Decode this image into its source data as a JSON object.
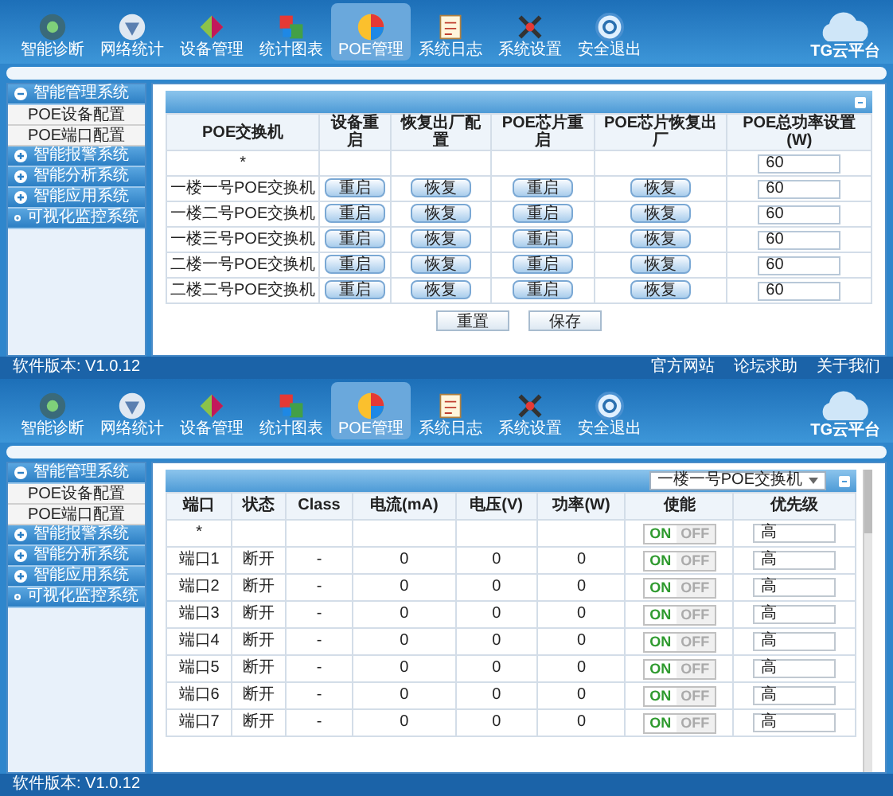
{
  "screens": [
    {
      "nav": [
        {
          "label": "智能诊断",
          "selected": false
        },
        {
          "label": "网络统计",
          "selected": false
        },
        {
          "label": "设备管理",
          "selected": false
        },
        {
          "label": "统计图表",
          "selected": false
        },
        {
          "label": "POE管理",
          "selected": true
        },
        {
          "label": "系统日志",
          "selected": false
        },
        {
          "label": "系统设置",
          "selected": false
        },
        {
          "label": "安全退出",
          "selected": false
        }
      ],
      "logo": "TG云平台",
      "sidebar": [
        {
          "label": "智能管理系统",
          "expanded": true,
          "children": [
            {
              "label": "POE设备配置"
            },
            {
              "label": "POE端口配置"
            }
          ]
        },
        {
          "label": "智能报警系统",
          "expanded": false
        },
        {
          "label": "智能分析系统",
          "expanded": false
        },
        {
          "label": "智能应用系统",
          "expanded": false
        },
        {
          "label": "可视化监控系统",
          "expanded": false
        }
      ],
      "panel": {
        "kind": "switch_table",
        "columns": [
          "POE交换机",
          "设备重启",
          "恢复出厂配置",
          "POE芯片重启",
          "POE芯片恢复出厂",
          "POE总功率设置(W)"
        ],
        "rows": [
          {
            "name": "*",
            "power": "60"
          },
          {
            "name": "一楼一号POE交换机",
            "restart": "重启",
            "reset": "恢复",
            "chip_restart": "重启",
            "chip_reset": "恢复",
            "power": "60"
          },
          {
            "name": "一楼二号POE交换机",
            "restart": "重启",
            "reset": "恢复",
            "chip_restart": "重启",
            "chip_reset": "恢复",
            "power": "60"
          },
          {
            "name": "一楼三号POE交换机",
            "restart": "重启",
            "reset": "恢复",
            "chip_restart": "重启",
            "chip_reset": "恢复",
            "power": "60"
          },
          {
            "name": "二楼一号POE交换机",
            "restart": "重启",
            "reset": "恢复",
            "chip_restart": "重启",
            "chip_reset": "恢复",
            "power": "60"
          },
          {
            "name": "二楼二号POE交换机",
            "restart": "重启",
            "reset": "恢复",
            "chip_restart": "重启",
            "chip_reset": "恢复",
            "power": "60"
          }
        ],
        "buttons": [
          "重置",
          "保存"
        ]
      },
      "footer": {
        "version": "软件版本: V1.0.12",
        "links": [
          "官方网站",
          "论坛求助",
          "关于我们"
        ]
      }
    },
    {
      "nav": [
        {
          "label": "智能诊断",
          "selected": false
        },
        {
          "label": "网络统计",
          "selected": false
        },
        {
          "label": "设备管理",
          "selected": false
        },
        {
          "label": "统计图表",
          "selected": false
        },
        {
          "label": "POE管理",
          "selected": true
        },
        {
          "label": "系统日志",
          "selected": false
        },
        {
          "label": "系统设置",
          "selected": false
        },
        {
          "label": "安全退出",
          "selected": false
        }
      ],
      "logo": "TG云平台",
      "sidebar": [
        {
          "label": "智能管理系统",
          "expanded": true,
          "children": [
            {
              "label": "POE设备配置"
            },
            {
              "label": "POE端口配置"
            }
          ]
        },
        {
          "label": "智能报警系统",
          "expanded": false
        },
        {
          "label": "智能分析系统",
          "expanded": false
        },
        {
          "label": "智能应用系统",
          "expanded": false
        },
        {
          "label": "可视化监控系统",
          "expanded": false
        }
      ],
      "panel": {
        "kind": "port_table",
        "switch_select": "一楼一号POE交换机",
        "columns": [
          "端口",
          "状态",
          "Class",
          "电流(mA)",
          "电压(V)",
          "功率(W)",
          "使能",
          "优先级"
        ],
        "rows": [
          {
            "port": "*",
            "enable": {
              "on": true,
              "on_text": "ON",
              "off_text": "OFF"
            },
            "priority": "高"
          },
          {
            "port": "端口1",
            "status": "断开",
            "class": "-",
            "current": "0",
            "voltage": "0",
            "power": "0",
            "enable": {
              "on": true,
              "on_text": "ON",
              "off_text": "OFF"
            },
            "priority": "高"
          },
          {
            "port": "端口2",
            "status": "断开",
            "class": "-",
            "current": "0",
            "voltage": "0",
            "power": "0",
            "enable": {
              "on": true,
              "on_text": "ON",
              "off_text": "OFF"
            },
            "priority": "高"
          },
          {
            "port": "端口3",
            "status": "断开",
            "class": "-",
            "current": "0",
            "voltage": "0",
            "power": "0",
            "enable": {
              "on": true,
              "on_text": "ON",
              "off_text": "OFF"
            },
            "priority": "高"
          },
          {
            "port": "端口4",
            "status": "断开",
            "class": "-",
            "current": "0",
            "voltage": "0",
            "power": "0",
            "enable": {
              "on": true,
              "on_text": "ON",
              "off_text": "OFF"
            },
            "priority": "高"
          },
          {
            "port": "端口5",
            "status": "断开",
            "class": "-",
            "current": "0",
            "voltage": "0",
            "power": "0",
            "enable": {
              "on": true,
              "on_text": "ON",
              "off_text": "OFF"
            },
            "priority": "高"
          },
          {
            "port": "端口6",
            "status": "断开",
            "class": "-",
            "current": "0",
            "voltage": "0",
            "power": "0",
            "enable": {
              "on": true,
              "on_text": "ON",
              "off_text": "OFF"
            },
            "priority": "高"
          },
          {
            "port": "端口7",
            "status": "断开",
            "class": "-",
            "current": "0",
            "voltage": "0",
            "power": "0",
            "enable": {
              "on": true,
              "on_text": "ON",
              "off_text": "OFF"
            },
            "priority": "高"
          }
        ]
      },
      "footer": {
        "version": "软件版本: V1.0.12"
      }
    }
  ]
}
